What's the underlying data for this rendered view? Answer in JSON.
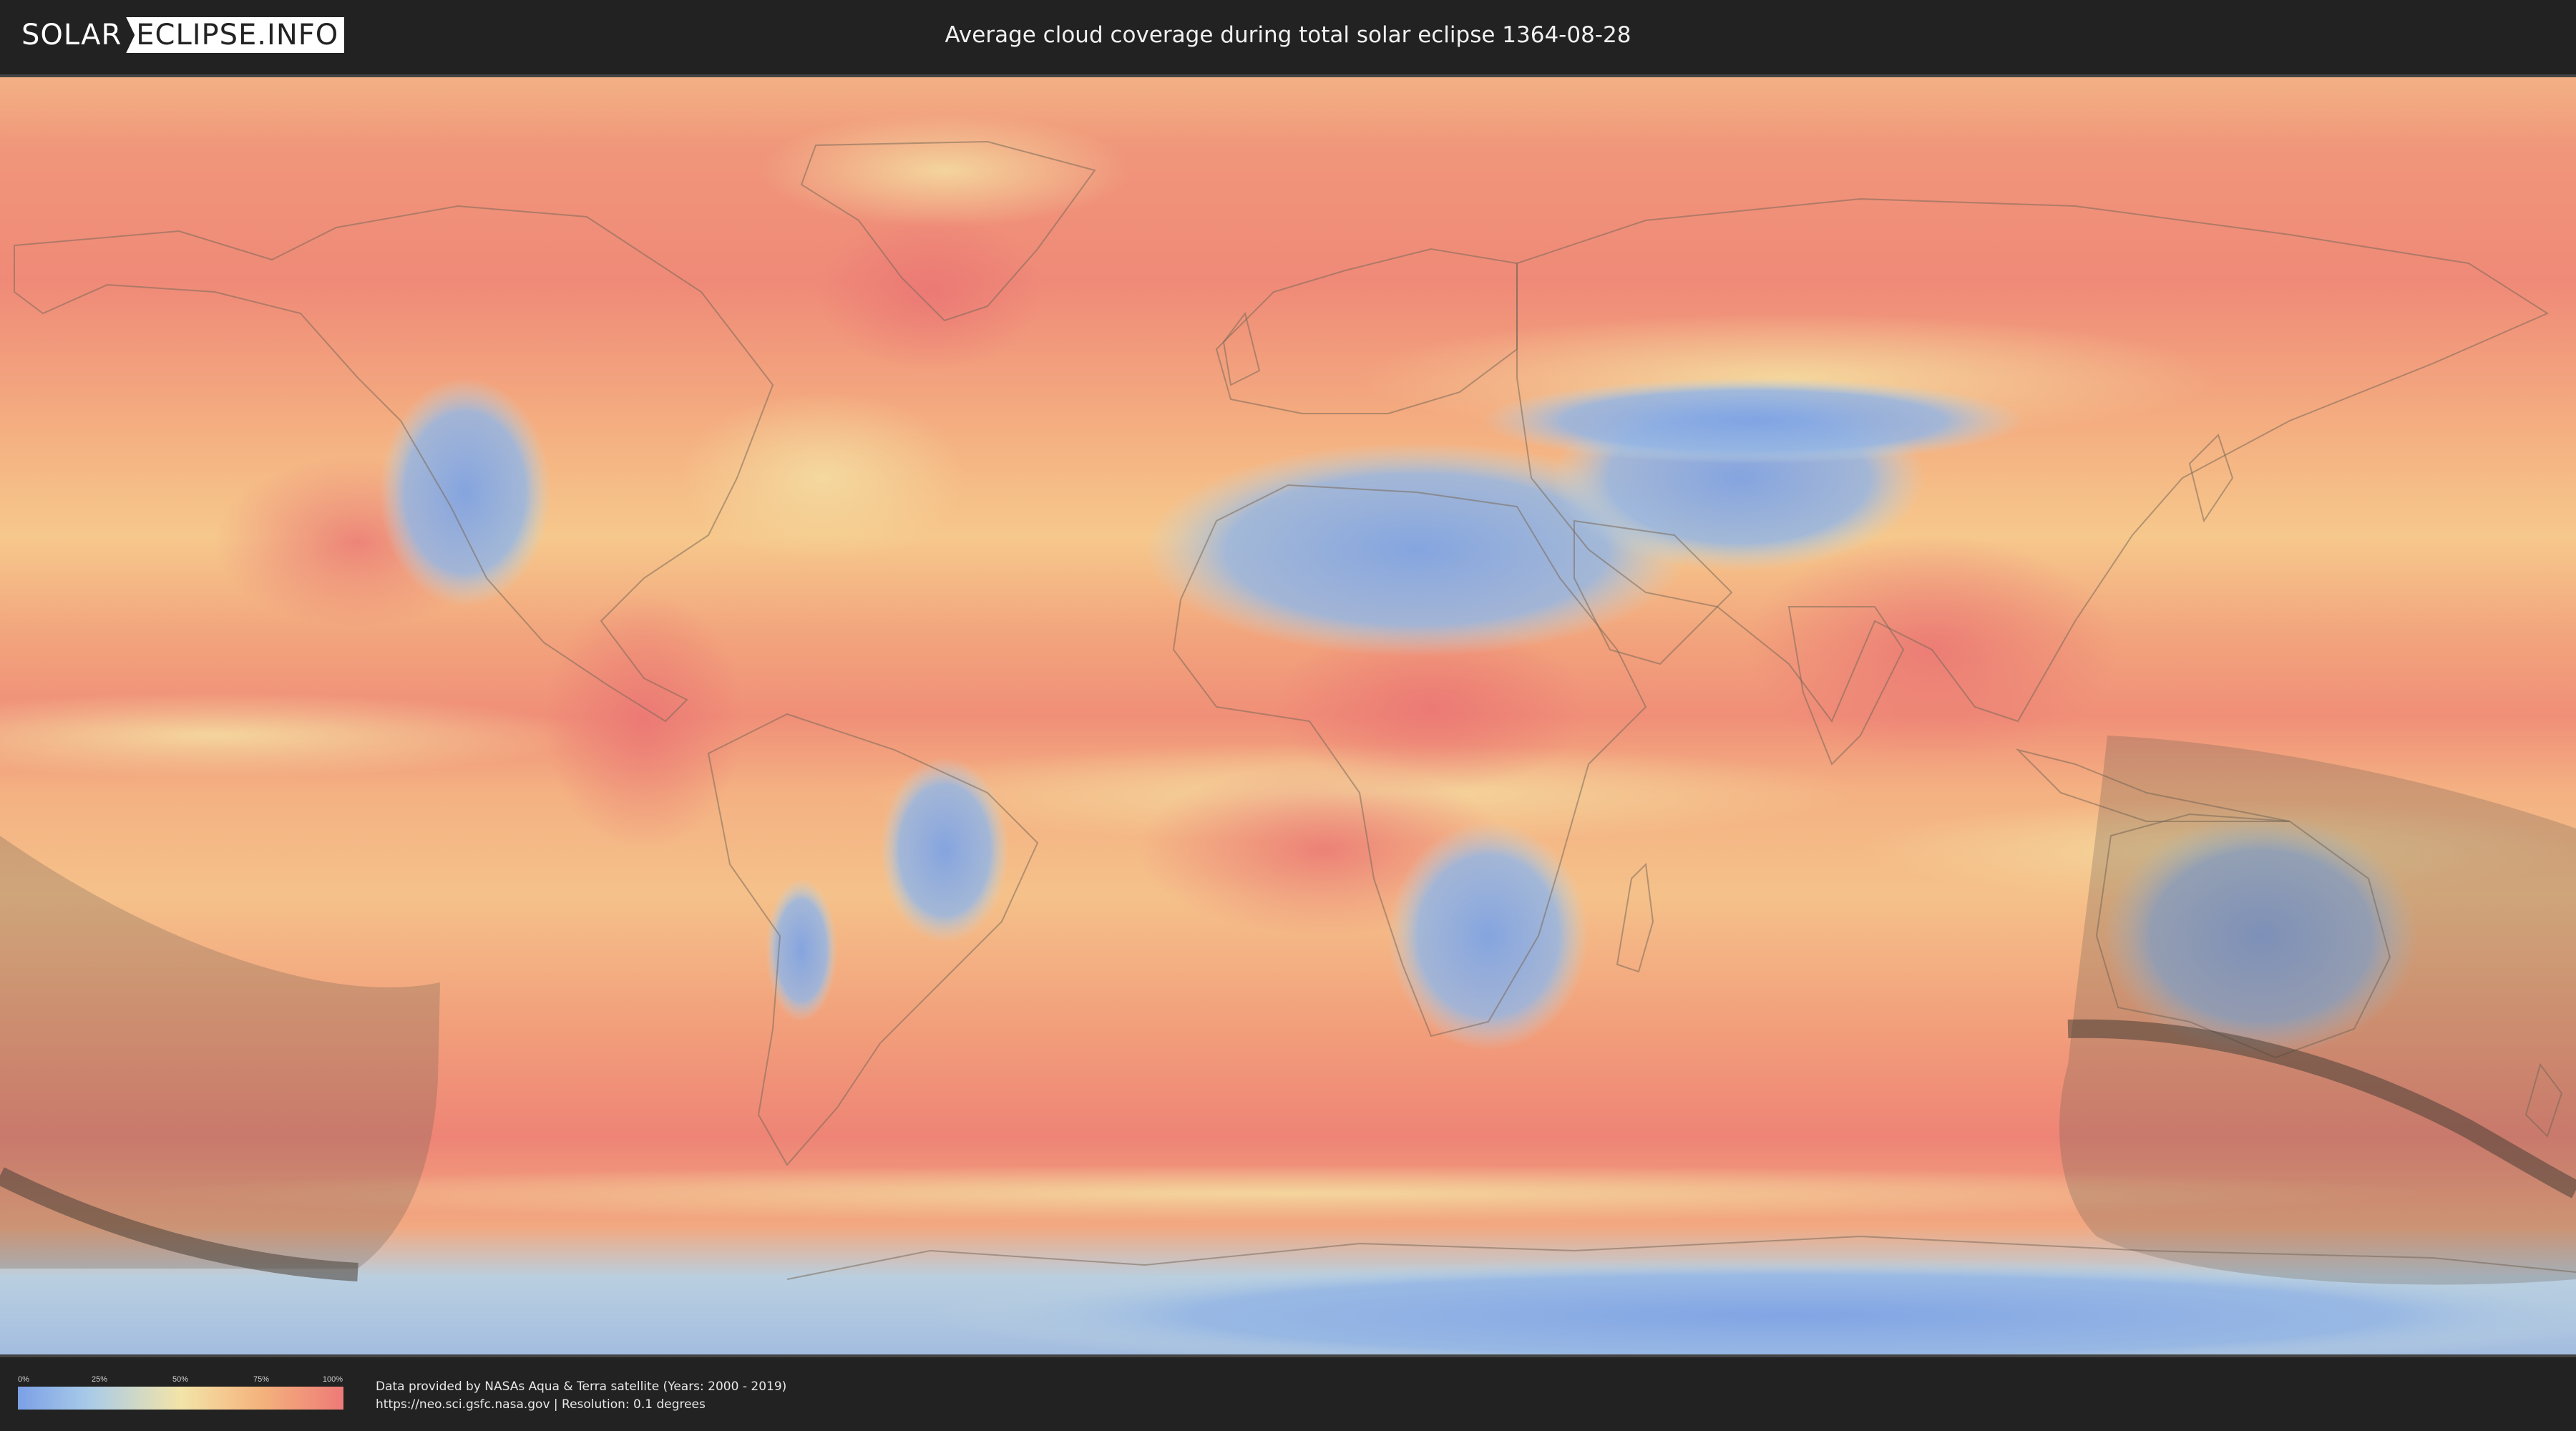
{
  "logo": {
    "left_text": "SOLAR",
    "right_text": "ECLIPSE.INFO"
  },
  "page_title": "Average cloud coverage during total solar eclipse 1364-08-28",
  "legend": {
    "ticks": [
      "0%",
      "25%",
      "50%",
      "75%",
      "100%"
    ],
    "tick_values": [
      0,
      25,
      50,
      75,
      100
    ],
    "colors": [
      "#7ba0e6",
      "#a9cbe8",
      "#f3e4a8",
      "#f4b27c",
      "#ee7a78"
    ]
  },
  "credits": {
    "line1": "Data provided by NASAs Aqua & Terra satellite (Years: 2000 - 2019)",
    "line2": "https://neo.sci.gsfc.nasa.gov | Resolution: 0.1 degrees"
  },
  "map": {
    "projection": "equirectangular",
    "ocean_color": "#f4a278",
    "clear_sky_color": "#86a8e2",
    "eclipse_shadow_color": "#5a5046"
  }
}
